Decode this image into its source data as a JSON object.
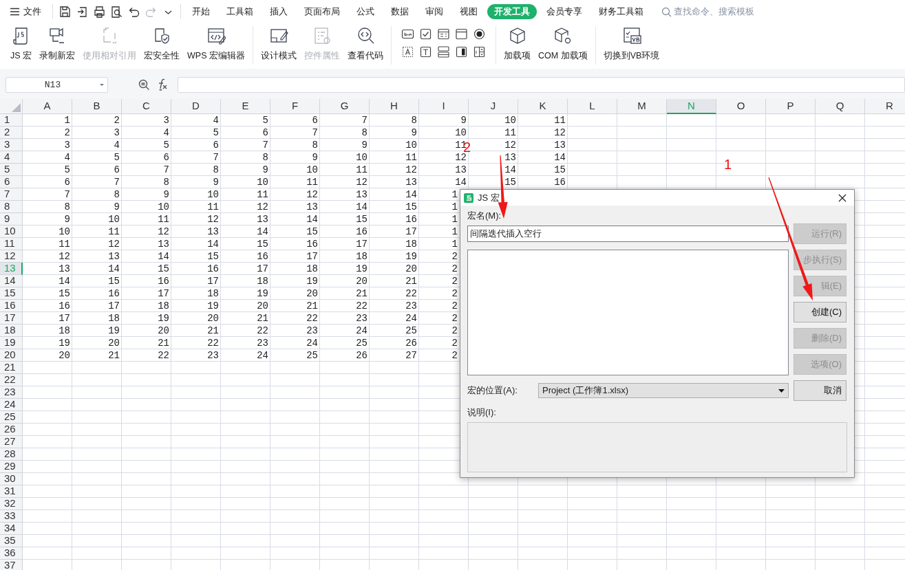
{
  "menu": {
    "label": "文件"
  },
  "quick_access": [
    {
      "kind": "save",
      "disabled": false
    },
    {
      "kind": "export",
      "disabled": false
    },
    {
      "kind": "print",
      "disabled": false
    },
    {
      "kind": "preview",
      "disabled": false
    },
    {
      "kind": "undo",
      "disabled": false
    },
    {
      "kind": "redo",
      "disabled": true
    },
    {
      "kind": "more",
      "disabled": false
    }
  ],
  "tabs": [
    {
      "label": "开始",
      "selected": false
    },
    {
      "label": "工具箱",
      "selected": false
    },
    {
      "label": "插入",
      "selected": false
    },
    {
      "label": "页面布局",
      "selected": false
    },
    {
      "label": "公式",
      "selected": false
    },
    {
      "label": "数据",
      "selected": false
    },
    {
      "label": "审阅",
      "selected": false
    },
    {
      "label": "视图",
      "selected": false
    },
    {
      "label": "开发工具",
      "selected": true
    },
    {
      "label": "会员专享",
      "selected": false
    },
    {
      "label": "财务工具箱",
      "selected": false
    }
  ],
  "search": {
    "placeholder": "查找命令、搜索模板"
  },
  "ribbon": [
    {
      "buttons": [
        {
          "kind": "js",
          "label": "JS 宏",
          "disabled": false
        },
        {
          "kind": "record",
          "label": "录制新宏",
          "disabled": false
        },
        {
          "kind": "relative",
          "label": "使用相对引用",
          "disabled": true
        },
        {
          "kind": "security",
          "label": "宏安全性",
          "disabled": false
        },
        {
          "kind": "editor",
          "label": "WPS 宏编辑器",
          "disabled": false
        }
      ]
    },
    {
      "buttons": [
        {
          "kind": "design",
          "label": "设计模式",
          "disabled": false
        },
        {
          "kind": "props",
          "label": "控件属性",
          "disabled": true
        },
        {
          "kind": "code",
          "label": "查看代码",
          "disabled": false
        }
      ]
    },
    {
      "controls": [
        {
          "kind": "button"
        },
        {
          "kind": "checkbox"
        },
        {
          "kind": "listbox"
        },
        {
          "kind": "frame"
        },
        {
          "kind": "radio"
        },
        {
          "kind": "label"
        },
        {
          "kind": "textbox"
        },
        {
          "kind": "button2"
        },
        {
          "kind": "toggle"
        },
        {
          "kind": "spinner"
        }
      ]
    },
    {
      "buttons": [
        {
          "kind": "addin",
          "label": "加载项",
          "disabled": false
        },
        {
          "kind": "com",
          "label": "COM 加载项",
          "disabled": false
        }
      ]
    },
    {
      "buttons": [
        {
          "kind": "vb",
          "label": "切换到VB环境",
          "disabled": false
        }
      ]
    }
  ],
  "formula_bar": {
    "name_box": "N13"
  },
  "sheet": {
    "columns": [
      {
        "label": "A",
        "selected": false
      },
      {
        "label": "B",
        "selected": false
      },
      {
        "label": "C",
        "selected": false
      },
      {
        "label": "D",
        "selected": false
      },
      {
        "label": "E",
        "selected": false
      },
      {
        "label": "F",
        "selected": false
      },
      {
        "label": "G",
        "selected": false
      },
      {
        "label": "H",
        "selected": false
      },
      {
        "label": "I",
        "selected": false
      },
      {
        "label": "J",
        "selected": false
      },
      {
        "label": "K",
        "selected": false
      },
      {
        "label": "L",
        "selected": false
      },
      {
        "label": "M",
        "selected": false
      },
      {
        "label": "N",
        "selected": true
      },
      {
        "label": "O",
        "selected": false
      },
      {
        "label": "P",
        "selected": false
      },
      {
        "label": "Q",
        "selected": false
      },
      {
        "label": "R",
        "selected": false
      }
    ],
    "rows": [
      {
        "number": "1",
        "selected": false,
        "cells": [
          "1",
          "2",
          "3",
          "4",
          "5",
          "6",
          "7",
          "8",
          "9",
          "10",
          "11"
        ]
      },
      {
        "number": "2",
        "selected": false,
        "cells": [
          "2",
          "3",
          "4",
          "5",
          "6",
          "7",
          "8",
          "9",
          "10",
          "11",
          "12"
        ]
      },
      {
        "number": "3",
        "selected": false,
        "cells": [
          "3",
          "4",
          "5",
          "6",
          "7",
          "8",
          "9",
          "10",
          "11",
          "12",
          "13"
        ]
      },
      {
        "number": "4",
        "selected": false,
        "cells": [
          "4",
          "5",
          "6",
          "7",
          "8",
          "9",
          "10",
          "11",
          "12",
          "13",
          "14"
        ]
      },
      {
        "number": "5",
        "selected": false,
        "cells": [
          "5",
          "6",
          "7",
          "8",
          "9",
          "10",
          "11",
          "12",
          "13",
          "14",
          "15"
        ]
      },
      {
        "number": "6",
        "selected": false,
        "cells": [
          "6",
          "7",
          "8",
          "9",
          "10",
          "11",
          "12",
          "13",
          "14",
          "15",
          "16"
        ]
      },
      {
        "number": "7",
        "selected": false,
        "cells": [
          "7",
          "8",
          "9",
          "10",
          "11",
          "12",
          "13",
          "14",
          "1"
        ]
      },
      {
        "number": "8",
        "selected": false,
        "cells": [
          "8",
          "9",
          "10",
          "11",
          "12",
          "13",
          "14",
          "15",
          "1"
        ]
      },
      {
        "number": "9",
        "selected": false,
        "cells": [
          "9",
          "10",
          "11",
          "12",
          "13",
          "14",
          "15",
          "16",
          "1"
        ]
      },
      {
        "number": "10",
        "selected": false,
        "cells": [
          "10",
          "11",
          "12",
          "13",
          "14",
          "15",
          "16",
          "17",
          "1"
        ]
      },
      {
        "number": "11",
        "selected": false,
        "cells": [
          "11",
          "12",
          "13",
          "14",
          "15",
          "16",
          "17",
          "18",
          "1"
        ]
      },
      {
        "number": "12",
        "selected": false,
        "cells": [
          "12",
          "13",
          "14",
          "15",
          "16",
          "17",
          "18",
          "19",
          "2"
        ]
      },
      {
        "number": "13",
        "selected": true,
        "cells": [
          "13",
          "14",
          "15",
          "16",
          "17",
          "18",
          "19",
          "20",
          "2"
        ]
      },
      {
        "number": "14",
        "selected": false,
        "cells": [
          "14",
          "15",
          "16",
          "17",
          "18",
          "19",
          "20",
          "21",
          "2"
        ]
      },
      {
        "number": "15",
        "selected": false,
        "cells": [
          "15",
          "16",
          "17",
          "18",
          "19",
          "20",
          "21",
          "22",
          "2"
        ]
      },
      {
        "number": "16",
        "selected": false,
        "cells": [
          "16",
          "17",
          "18",
          "19",
          "20",
          "21",
          "22",
          "23",
          "2"
        ]
      },
      {
        "number": "17",
        "selected": false,
        "cells": [
          "17",
          "18",
          "19",
          "20",
          "21",
          "22",
          "23",
          "24",
          "2"
        ]
      },
      {
        "number": "18",
        "selected": false,
        "cells": [
          "18",
          "19",
          "20",
          "21",
          "22",
          "23",
          "24",
          "25",
          "2"
        ]
      },
      {
        "number": "19",
        "selected": false,
        "cells": [
          "19",
          "20",
          "21",
          "22",
          "23",
          "24",
          "25",
          "26",
          "2"
        ]
      },
      {
        "number": "20",
        "selected": false,
        "cells": [
          "20",
          "21",
          "22",
          "23",
          "24",
          "25",
          "26",
          "27",
          "2"
        ]
      },
      {
        "number": "21",
        "selected": false
      },
      {
        "number": "22",
        "selected": false
      },
      {
        "number": "23",
        "selected": false
      },
      {
        "number": "24",
        "selected": false
      },
      {
        "number": "25",
        "selected": false
      },
      {
        "number": "26",
        "selected": false
      },
      {
        "number": "27",
        "selected": false
      },
      {
        "number": "28",
        "selected": false
      },
      {
        "number": "29",
        "selected": false
      },
      {
        "number": "30",
        "selected": false
      },
      {
        "number": "31",
        "selected": false
      },
      {
        "number": "32",
        "selected": false
      },
      {
        "number": "33",
        "selected": false
      },
      {
        "number": "34",
        "selected": false
      },
      {
        "number": "35",
        "selected": false
      },
      {
        "number": "36",
        "selected": false
      },
      {
        "number": "37",
        "selected": false
      }
    ]
  },
  "dialog": {
    "title": "JS 宏",
    "name_label": "宏名(M):",
    "name_value": "间隔迭代插入空行",
    "buttons": [
      {
        "label": "运行(R)",
        "disabled": true
      },
      {
        "label": "步执行(S)",
        "disabled": true
      },
      {
        "label": "辑(E)",
        "disabled": true
      },
      {
        "label": "创建(C)",
        "disabled": false
      },
      {
        "label": "删除(D)",
        "disabled": true
      },
      {
        "label": "选项(O)",
        "disabled": true
      },
      {
        "label": "取消",
        "disabled": false
      }
    ],
    "location_label": "宏的位置(A):",
    "location_value": "Project (工作簿1.xlsx)",
    "description_label": "说明(I):"
  },
  "annotations": [
    {
      "label": "2"
    },
    {
      "label": "1"
    }
  ]
}
